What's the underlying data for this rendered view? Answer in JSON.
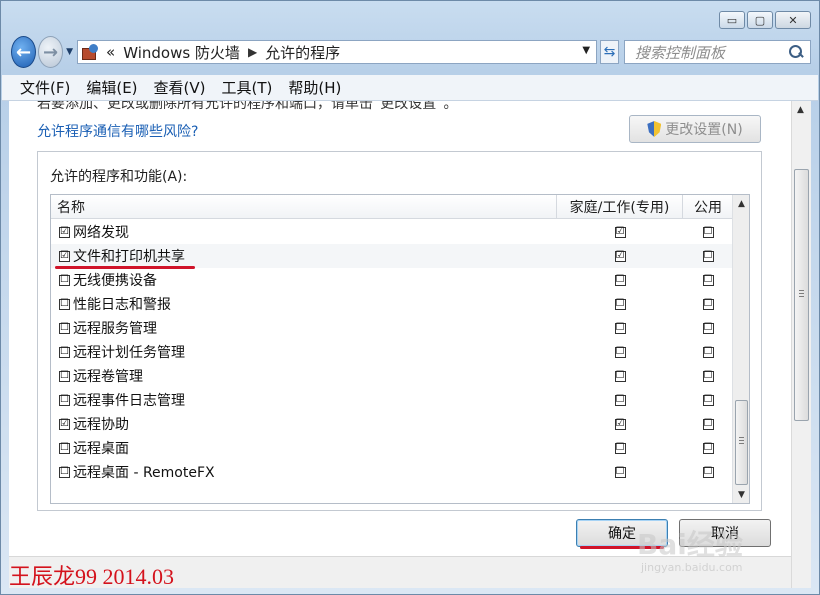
{
  "window": {
    "minimize_glyph": "▭",
    "maximize_glyph": "▢",
    "close_glyph": "✕"
  },
  "navigation": {
    "back_glyph": "←",
    "forward_glyph": "→",
    "dropdown_glyph": "▼",
    "breadcrumb_chevron": "«",
    "breadcrumb_root": "Windows 防火墙",
    "breadcrumb_separator": "▶",
    "breadcrumb_current": "允许的程序",
    "refresh_glyph": "⇆",
    "search_placeholder": "搜索控制面板"
  },
  "menubar": {
    "items": [
      {
        "label": "文件(F)"
      },
      {
        "label": "编辑(E)"
      },
      {
        "label": "查看(V)"
      },
      {
        "label": "工具(T)"
      },
      {
        "label": "帮助(H)"
      }
    ]
  },
  "content": {
    "top_cut_text": "若要添加、更改或删除所有允许的程序和端口，请单击“更改设置”。",
    "risk_link": "允许程序通信有哪些风险?",
    "change_settings_label": "更改设置(N)",
    "group_title": "允许的程序和功能(A):",
    "columns": {
      "name": "名称",
      "home_work": "家庭/工作(专用)",
      "public": "公用"
    },
    "rows": [
      {
        "name": "网络发现",
        "checked": "☑",
        "home": "☑",
        "public": "☐"
      },
      {
        "name": "文件和打印机共享",
        "checked": "☑",
        "home": "☑",
        "public": "☐"
      },
      {
        "name": "无线便携设备",
        "checked": "☐",
        "home": "☐",
        "public": "☐"
      },
      {
        "name": "性能日志和警报",
        "checked": "☐",
        "home": "☐",
        "public": "☐"
      },
      {
        "name": "远程服务管理",
        "checked": "☐",
        "home": "☐",
        "public": "☐"
      },
      {
        "name": "远程计划任务管理",
        "checked": "☐",
        "home": "☐",
        "public": "☐"
      },
      {
        "name": "远程卷管理",
        "checked": "☐",
        "home": "☐",
        "public": "☐"
      },
      {
        "name": "远程事件日志管理",
        "checked": "☐",
        "home": "☐",
        "public": "☐"
      },
      {
        "name": "远程协助",
        "checked": "☑",
        "home": "☑",
        "public": "☐"
      },
      {
        "name": "远程桌面",
        "checked": "☐",
        "home": "☐",
        "public": "☐"
      },
      {
        "name": "远程桌面 - RemoteFX",
        "checked": "☐",
        "home": "☐",
        "public": "☐"
      }
    ],
    "scroll_up_glyph": "▲",
    "scroll_down_glyph": "▼",
    "ok_label": "确定",
    "cancel_label": "取消"
  },
  "annotation": {
    "author_text": "王辰龙99 2014.03",
    "highlight_color": "#d0142a"
  },
  "watermark": {
    "brand": "Bai经验",
    "domain": "jingyan.baidu.com"
  }
}
